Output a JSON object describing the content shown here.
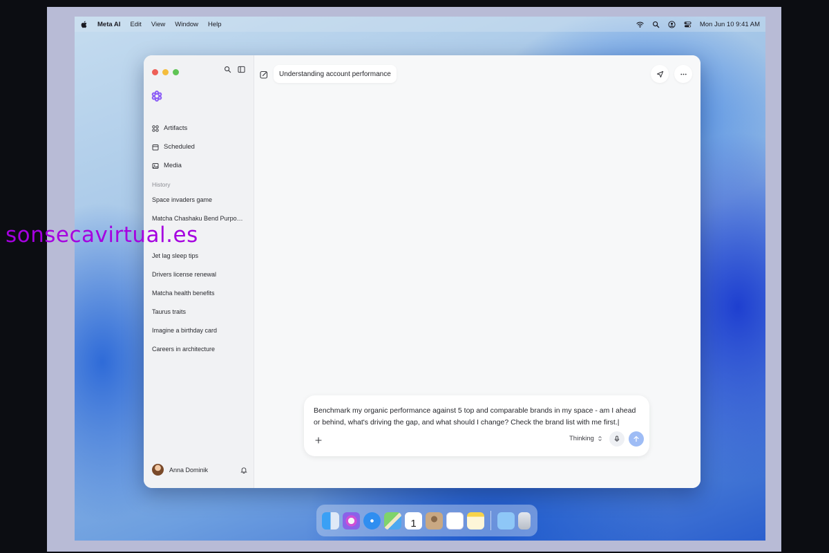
{
  "menubar": {
    "app_name": "Meta AI",
    "items": [
      "Edit",
      "View",
      "Window",
      "Help"
    ],
    "datetime": "Mon Jun 10  9:41 AM"
  },
  "window": {
    "title": "Understanding account performance",
    "sidebar": {
      "nav": [
        {
          "label": "Artifacts",
          "icon": "artifacts-icon"
        },
        {
          "label": "Scheduled",
          "icon": "calendar-icon"
        },
        {
          "label": "Media",
          "icon": "image-icon"
        }
      ],
      "history_label": "History",
      "history": [
        "Space invaders game",
        "Matcha Chashaku Bend Purpo…",
        "",
        "Jet lag sleep tips",
        "Drivers license renewal",
        "Matcha health benefits",
        "Taurus traits",
        "Imagine a birthday card",
        "Careers in architecture"
      ],
      "profile_name": "Anna Dominik"
    },
    "composer": {
      "text": "Benchmark my organic performance against 5 top and comparable brands in my space - am I ahead or behind, what's driving the gap, and what should I change? Check the brand list with me first.|",
      "mode": "Thinking"
    }
  },
  "dock": {
    "apps": [
      "finder",
      "photos",
      "safari",
      "maps",
      "calendar",
      "contacts",
      "reminders",
      "notes",
      "folder",
      "trash"
    ],
    "calendar_day": "1"
  },
  "watermark": "sonsecavirtual.es",
  "colors": {
    "accent_purple": "#8b5cf6",
    "send_button": "#9ebcf5",
    "watermark": "#a500e0"
  }
}
